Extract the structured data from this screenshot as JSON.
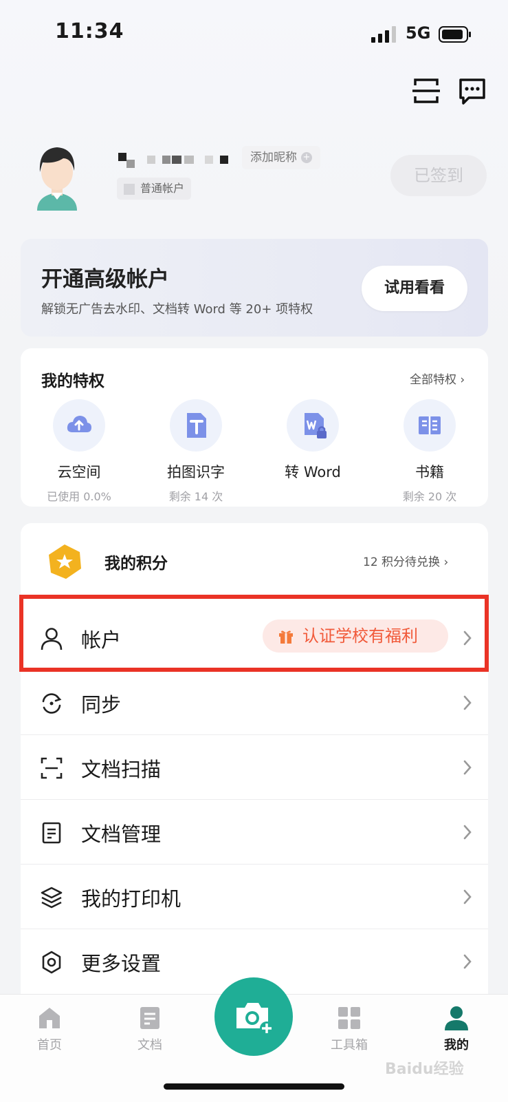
{
  "status_bar": {
    "time": "11:34",
    "network": "5G"
  },
  "profile": {
    "add_nickname": "添加昵称",
    "plus": "+",
    "account_type": "普通帐户",
    "checkin": "已签到"
  },
  "premium": {
    "title": "开通高级帐户",
    "desc": "解锁无广告去水印、文档转 Word 等 20+ 项特权",
    "trial_button": "试用看看"
  },
  "privileges": {
    "title": "我的特权",
    "all_link": "全部特权 ›",
    "items": [
      {
        "label": "云空间",
        "sub": "已使用 0.0%",
        "icon": "cloud-upload-icon"
      },
      {
        "label": "拍图识字",
        "sub": "剩余 14 次",
        "icon": "text-recognition-icon"
      },
      {
        "label": "转 Word",
        "sub": "",
        "icon": "word-lock-icon"
      },
      {
        "label": "书籍",
        "sub": "剩余 20 次",
        "icon": "book-icon"
      }
    ]
  },
  "points": {
    "label": "我的积分",
    "right": "12 积分待兑换 ›"
  },
  "menu": [
    {
      "label": "帐户",
      "icon": "user-icon",
      "promo": "认证学校有福利"
    },
    {
      "label": "同步",
      "icon": "sync-icon"
    },
    {
      "label": "文档扫描",
      "icon": "scan-icon"
    },
    {
      "label": "文档管理",
      "icon": "document-icon"
    },
    {
      "label": "我的打印机",
      "icon": "layers-icon"
    },
    {
      "label": "更多设置",
      "icon": "settings-icon"
    }
  ],
  "bottom_nav": [
    {
      "label": "首页",
      "icon": "home-icon",
      "active": false
    },
    {
      "label": "文档",
      "icon": "document-icon",
      "active": false
    },
    {
      "label": "工具箱",
      "icon": "grid-icon",
      "active": false
    },
    {
      "label": "我的",
      "icon": "person-icon",
      "active": true
    }
  ],
  "watermark": "Baidu经验",
  "colors": {
    "accent": "#1fae96",
    "highlight": "#ea3326",
    "promo_text": "#f15a3a",
    "promo_bg": "#fde9e6"
  }
}
